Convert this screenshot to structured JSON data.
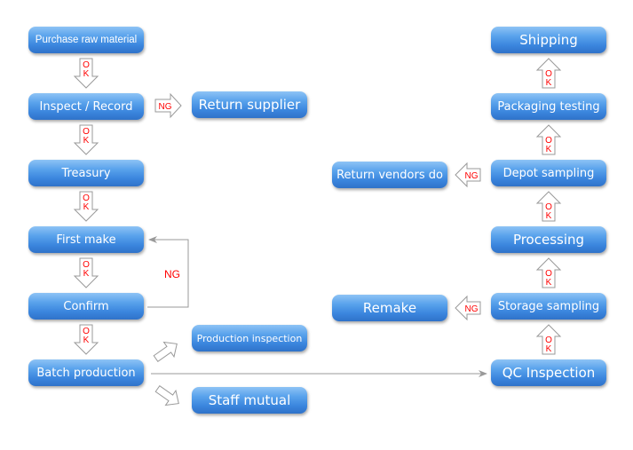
{
  "diagram": {
    "nodes": {
      "purchase": "Purchase raw material",
      "inspect": "Inspect / Record",
      "return_supplier": "Return supplier",
      "treasury": "Treasury",
      "first_make": "First make",
      "confirm": "Confirm",
      "batch": "Batch production",
      "production_inspection": "Production inspection",
      "staff_mutual": "Staff mutual",
      "qc_inspection": "QC Inspection",
      "storage_sampling": "Storage sampling",
      "remake": "Remake",
      "processing": "Processing",
      "depot_sampling": "Depot sampling",
      "return_vendors": "Return vendors do",
      "packaging_testing": "Packaging testing",
      "shipping": "Shipping"
    },
    "labels": {
      "ok_top": "O",
      "ok_bottom": "K",
      "ng": "NG"
    },
    "colors": {
      "box_top": "#8ec3f5",
      "box_bottom": "#2f72c9",
      "label_red": "#ff0000",
      "connector_gray": "#999999"
    }
  }
}
